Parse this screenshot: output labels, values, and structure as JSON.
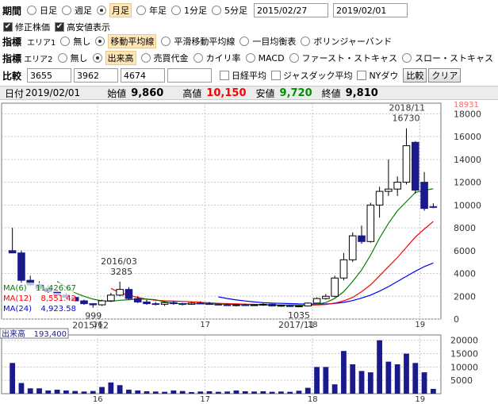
{
  "controls": {
    "period_label": "期間",
    "period_options": [
      {
        "label": "日足",
        "selected": false
      },
      {
        "label": "週足",
        "selected": false
      },
      {
        "label": "月足",
        "selected": true
      },
      {
        "label": "年足",
        "selected": false
      },
      {
        "label": "1分足",
        "selected": false
      },
      {
        "label": "5分足",
        "selected": false
      }
    ],
    "date_from": "2015/02/27",
    "date_to": "2019/02/01",
    "adjusted_price_label": "修正株価",
    "adjusted_price_checked": true,
    "show_high_low_label": "高安値表示",
    "show_high_low_checked": true,
    "indicator1_label": "指標",
    "indicator1_area": "エリア1",
    "indicator1_options": [
      {
        "label": "無し",
        "selected": false
      },
      {
        "label": "移動平均線",
        "selected": true
      },
      {
        "label": "平滑移動平均線",
        "selected": false
      },
      {
        "label": "一目均衡表",
        "selected": false
      },
      {
        "label": "ボリンジャーバンド",
        "selected": false
      }
    ],
    "indicator2_label": "指標",
    "indicator2_area": "エリア2",
    "indicator2_options": [
      {
        "label": "無し",
        "selected": false
      },
      {
        "label": "出来高",
        "selected": true
      },
      {
        "label": "売買代金",
        "selected": false
      },
      {
        "label": "カイリ率",
        "selected": false
      },
      {
        "label": "MACD",
        "selected": false
      },
      {
        "label": "ファースト・ストキャス",
        "selected": false
      },
      {
        "label": "スロー・ストキャス",
        "selected": false
      }
    ],
    "compare_label": "比較",
    "compare_codes": [
      "3655",
      "3962",
      "4674",
      ""
    ],
    "compare_checks": [
      {
        "label": "日経平均",
        "checked": false
      },
      {
        "label": "ジャスダック平均",
        "checked": false
      },
      {
        "label": "NYダウ",
        "checked": false
      }
    ],
    "compare_button": "比較",
    "clear_button": "クリア"
  },
  "info": {
    "date_label": "日付",
    "date_value": "2019/02/01",
    "open_label": "始値",
    "open_value": "9,860",
    "high_label": "高値",
    "high_value": "10,150",
    "low_label": "安値",
    "low_value": "9,720",
    "close_label": "終値",
    "close_value": "9,810"
  },
  "colors": {
    "high": "#ff0000",
    "low": "#00a000",
    "up_candle": "#ffffff",
    "down_candle": "#1a1a8c",
    "ma6": "#008000",
    "ma12": "#ff0000",
    "ma24": "#0000ff",
    "volume_bar": "#1a1a8c",
    "max_marker": "#ff6666"
  },
  "chart_data": [
    {
      "type": "candlestick",
      "title": "",
      "x_tick_labels": [
        "16",
        "17",
        "18",
        "19"
      ],
      "y_tick_labels": [
        "0",
        "2000",
        "4000",
        "6000",
        "8000",
        "10000",
        "12000",
        "14000",
        "16000",
        "18000"
      ],
      "ylim": [
        0,
        18931
      ],
      "y_max_label": "18931",
      "grid": true,
      "annotations": [
        {
          "text": "2018/11",
          "index": 44
        },
        {
          "text": "16730",
          "index": 44
        },
        {
          "text": "2016/03",
          "index": 12
        },
        {
          "text": "3285",
          "index": 12
        },
        {
          "text": "999",
          "index": 9
        },
        {
          "text": "2015/12",
          "index": 9
        },
        {
          "text": "1035",
          "index": 32
        },
        {
          "text": "2017/11",
          "index": 32
        }
      ],
      "ma_legend": [
        {
          "name": "MA(6)",
          "value": "11,426.67",
          "color_key": "ma6"
        },
        {
          "name": "MA(12)",
          "value": "8,551.42",
          "color_key": "ma12"
        },
        {
          "name": "MA(24)",
          "value": "4,923.58",
          "color_key": "ma24"
        }
      ],
      "candles": [
        {
          "o": 6000,
          "h": 8000,
          "l": 5800,
          "c": 5800
        },
        {
          "o": 5800,
          "h": 6000,
          "l": 3200,
          "c": 3400
        },
        {
          "o": 3400,
          "h": 3800,
          "l": 2900,
          "c": 3000
        },
        {
          "o": 3000,
          "h": 3300,
          "l": 2600,
          "c": 2700
        },
        {
          "o": 2700,
          "h": 3000,
          "l": 2300,
          "c": 2400
        },
        {
          "o": 2400,
          "h": 2600,
          "l": 2000,
          "c": 2100
        },
        {
          "o": 2100,
          "h": 2300,
          "l": 1800,
          "c": 1900
        },
        {
          "o": 1900,
          "h": 2000,
          "l": 1500,
          "c": 1600
        },
        {
          "o": 1600,
          "h": 1700,
          "l": 1250,
          "c": 1350
        },
        {
          "o": 1350,
          "h": 1400,
          "l": 999,
          "c": 1250
        },
        {
          "o": 1250,
          "h": 1700,
          "l": 1150,
          "c": 1600
        },
        {
          "o": 1600,
          "h": 2300,
          "l": 1500,
          "c": 2100
        },
        {
          "o": 2100,
          "h": 3285,
          "l": 2000,
          "c": 2600
        },
        {
          "o": 2600,
          "h": 2800,
          "l": 1700,
          "c": 1800
        },
        {
          "o": 1800,
          "h": 2000,
          "l": 1400,
          "c": 1500
        },
        {
          "o": 1500,
          "h": 1700,
          "l": 1250,
          "c": 1350
        },
        {
          "o": 1350,
          "h": 1500,
          "l": 1200,
          "c": 1300
        },
        {
          "o": 1300,
          "h": 1550,
          "l": 1150,
          "c": 1450
        },
        {
          "o": 1450,
          "h": 1600,
          "l": 1250,
          "c": 1350
        },
        {
          "o": 1350,
          "h": 1450,
          "l": 1200,
          "c": 1300
        },
        {
          "o": 1300,
          "h": 1500,
          "l": 1250,
          "c": 1400
        },
        {
          "o": 1400,
          "h": 1550,
          "l": 1300,
          "c": 1350
        },
        {
          "o": 1350,
          "h": 1500,
          "l": 1250,
          "c": 1300
        },
        {
          "o": 1300,
          "h": 1400,
          "l": 1200,
          "c": 1250
        },
        {
          "o": 1250,
          "h": 1350,
          "l": 1150,
          "c": 1200
        },
        {
          "o": 1200,
          "h": 1300,
          "l": 1100,
          "c": 1250
        },
        {
          "o": 1250,
          "h": 1350,
          "l": 1150,
          "c": 1200
        },
        {
          "o": 1200,
          "h": 1300,
          "l": 1150,
          "c": 1250
        },
        {
          "o": 1250,
          "h": 1400,
          "l": 1150,
          "c": 1300
        },
        {
          "o": 1300,
          "h": 1350,
          "l": 1100,
          "c": 1150
        },
        {
          "o": 1150,
          "h": 1250,
          "l": 1080,
          "c": 1200
        },
        {
          "o": 1200,
          "h": 1250,
          "l": 1060,
          "c": 1100
        },
        {
          "o": 1100,
          "h": 1200,
          "l": 1035,
          "c": 1150
        },
        {
          "o": 1150,
          "h": 1450,
          "l": 1100,
          "c": 1400
        },
        {
          "o": 1400,
          "h": 1900,
          "l": 1350,
          "c": 1800
        },
        {
          "o": 1800,
          "h": 2200,
          "l": 1700,
          "c": 2000
        },
        {
          "o": 2000,
          "h": 3800,
          "l": 1900,
          "c": 3600
        },
        {
          "o": 3600,
          "h": 5800,
          "l": 3400,
          "c": 5200
        },
        {
          "o": 5200,
          "h": 7600,
          "l": 5000,
          "c": 7300
        },
        {
          "o": 7300,
          "h": 8200,
          "l": 6600,
          "c": 6800
        },
        {
          "o": 6800,
          "h": 10200,
          "l": 6700,
          "c": 10000
        },
        {
          "o": 10000,
          "h": 11600,
          "l": 8900,
          "c": 11200
        },
        {
          "o": 11200,
          "h": 14000,
          "l": 10800,
          "c": 11400
        },
        {
          "o": 11400,
          "h": 12500,
          "l": 10800,
          "c": 12000
        },
        {
          "o": 12000,
          "h": 16730,
          "l": 11800,
          "c": 15200
        },
        {
          "o": 15500,
          "h": 15600,
          "l": 11000,
          "c": 11300
        },
        {
          "o": 12000,
          "h": 12900,
          "l": 9500,
          "c": 9700
        },
        {
          "o": 9860,
          "h": 10150,
          "l": 9720,
          "c": 9810
        }
      ],
      "ma6": [
        null,
        null,
        null,
        null,
        null,
        3300,
        2800,
        2300,
        2000,
        1750,
        1600,
        1550,
        1650,
        1700,
        1750,
        1750,
        1700,
        1500,
        1380,
        1350,
        1340,
        1340,
        1330,
        1320,
        1300,
        1280,
        1260,
        1250,
        1240,
        1230,
        1220,
        1210,
        1200,
        1220,
        1300,
        1450,
        1800,
        2400,
        3300,
        4300,
        5600,
        7100,
        8400,
        9500,
        10300,
        11100,
        11300,
        11427
      ],
      "ma12": [
        null,
        null,
        null,
        null,
        null,
        null,
        null,
        null,
        null,
        null,
        null,
        2700,
        2300,
        2100,
        1900,
        1750,
        1650,
        1600,
        1570,
        1550,
        1520,
        1470,
        1420,
        1380,
        1350,
        1330,
        1310,
        1290,
        1270,
        1250,
        1240,
        1230,
        1220,
        1220,
        1240,
        1280,
        1400,
        1600,
        1900,
        2400,
        3000,
        3800,
        4600,
        5400,
        6300,
        7200,
        7900,
        8551
      ],
      "ma24": [
        null,
        null,
        null,
        null,
        null,
        null,
        null,
        null,
        null,
        null,
        null,
        null,
        null,
        null,
        null,
        null,
        null,
        null,
        null,
        null,
        null,
        null,
        null,
        1950,
        1800,
        1680,
        1590,
        1500,
        1440,
        1400,
        1380,
        1360,
        1330,
        1320,
        1310,
        1320,
        1370,
        1460,
        1620,
        1840,
        2100,
        2450,
        2850,
        3300,
        3750,
        4200,
        4600,
        4924
      ]
    },
    {
      "type": "bar",
      "title": "出来高",
      "legend_value": "193,400",
      "x_tick_labels": [
        "16",
        "17",
        "18",
        "19"
      ],
      "y_tick_labels": [
        "5000",
        "10000",
        "15000",
        "20000"
      ],
      "ylim": [
        0,
        22000
      ],
      "values": [
        11500,
        4000,
        2000,
        2000,
        1200,
        1500,
        1200,
        1000,
        800,
        1000,
        2500,
        4200,
        3200,
        1500,
        1200,
        900,
        800,
        700,
        1200,
        1000,
        600,
        800,
        900,
        700,
        800,
        1200,
        900,
        800,
        900,
        700,
        800,
        700,
        1100,
        2200,
        10000,
        10000,
        3500,
        16000,
        11000,
        8500,
        8000,
        20000,
        12000,
        11000,
        15000,
        11500,
        8000,
        1800
      ]
    }
  ]
}
